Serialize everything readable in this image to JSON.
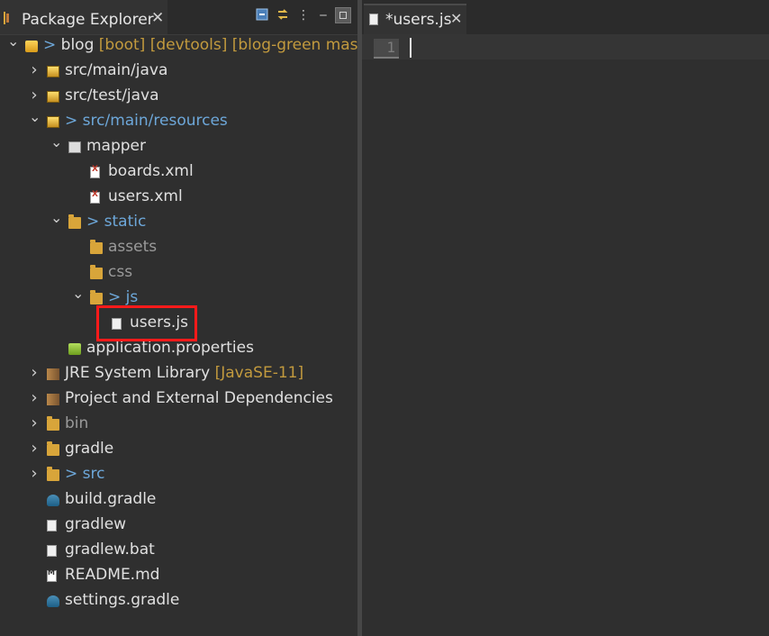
{
  "explorer": {
    "tab_title": "Package Explorer",
    "close_glyph": "✕",
    "toolbar": {
      "collapse_icon": "collapse-all-icon",
      "link_icon": "link-with-editor-icon",
      "menu_glyph": "⋮",
      "minimize_glyph": "‒",
      "maximize_icon": "maximize-icon"
    }
  },
  "tree": [
    {
      "indent": 0,
      "twisty": "v",
      "icon": "project",
      "label": "blog",
      "prefix": "> ",
      "deco": "[boot] [devtools] [blog-green master]"
    },
    {
      "indent": 1,
      "twisty": ">",
      "icon": "pkg",
      "label": "src/main/java"
    },
    {
      "indent": 1,
      "twisty": ">",
      "icon": "pkg",
      "label": "src/test/java"
    },
    {
      "indent": 1,
      "twisty": "v",
      "icon": "pkg",
      "label": "src/main/resources",
      "prefix": "> ",
      "blue": true
    },
    {
      "indent": 2,
      "twisty": "v",
      "icon": "mapper",
      "label": "mapper"
    },
    {
      "indent": 3,
      "twisty": "",
      "icon": "xml",
      "label": "boards.xml"
    },
    {
      "indent": 3,
      "twisty": "",
      "icon": "xml",
      "label": "users.xml"
    },
    {
      "indent": 2,
      "twisty": "v",
      "icon": "folder",
      "label": "static",
      "prefix": "> ",
      "blue": true
    },
    {
      "indent": 3,
      "twisty": "",
      "icon": "folder",
      "label": "assets",
      "gray": true
    },
    {
      "indent": 3,
      "twisty": "",
      "icon": "folder",
      "label": "css",
      "gray": true
    },
    {
      "indent": 3,
      "twisty": "v",
      "icon": "folder",
      "label": "js",
      "prefix": "> ",
      "blue": true
    },
    {
      "indent": 4,
      "twisty": "",
      "icon": "file",
      "label": "users.js"
    },
    {
      "indent": 2,
      "twisty": "",
      "icon": "props",
      "label": "application.properties"
    },
    {
      "indent": 1,
      "twisty": ">",
      "icon": "lib",
      "label": "JRE System Library",
      "deco": "[JavaSE-11]"
    },
    {
      "indent": 1,
      "twisty": ">",
      "icon": "lib",
      "label": "Project and External Dependencies"
    },
    {
      "indent": 1,
      "twisty": ">",
      "icon": "folder",
      "label": "bin",
      "gray": true
    },
    {
      "indent": 1,
      "twisty": ">",
      "icon": "folder",
      "label": "gradle"
    },
    {
      "indent": 1,
      "twisty": ">",
      "icon": "folder",
      "label": "src",
      "prefix": "> ",
      "blue": true
    },
    {
      "indent": 1,
      "twisty": "",
      "icon": "gradle",
      "label": "build.gradle"
    },
    {
      "indent": 1,
      "twisty": "",
      "icon": "file",
      "label": "gradlew"
    },
    {
      "indent": 1,
      "twisty": "",
      "icon": "file",
      "label": "gradlew.bat"
    },
    {
      "indent": 1,
      "twisty": "",
      "icon": "md",
      "label": "README.md"
    },
    {
      "indent": 1,
      "twisty": "",
      "icon": "gradle",
      "label": "settings.gradle"
    }
  ],
  "editor": {
    "tab_title": "*users.js",
    "close_glyph": "✕",
    "line_number": "1"
  },
  "colors": {
    "highlight_border": "#ff1a1a",
    "decoration": "#c29a3e",
    "link_blue": "#6da7d9"
  }
}
